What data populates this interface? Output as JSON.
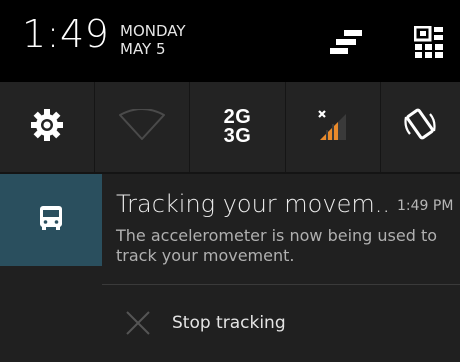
{
  "status": {
    "time": "1:49",
    "day": "MONDAY",
    "date": "MAY 5"
  },
  "header_icons": [
    "settings-panel-icon",
    "qr-user-icon"
  ],
  "quick_settings": [
    {
      "name": "settings",
      "icon": "gear-icon"
    },
    {
      "name": "wifi",
      "icon": "wifi-icon",
      "state": "off"
    },
    {
      "name": "network-mode",
      "text": "2G\n3G"
    },
    {
      "name": "mobile-signal",
      "icon": "signal-icon"
    },
    {
      "name": "auto-rotate",
      "icon": "rotate-icon"
    }
  ],
  "notification": {
    "icon": "bus-icon",
    "title": "Tracking your movem..",
    "time": "1:49 PM",
    "body": "The accelerometer is now being used to track your movement.",
    "action": {
      "label": "Stop tracking",
      "icon": "close-icon"
    }
  },
  "colors": {
    "accent": "#2a4f5e",
    "signal": "#e98a2b"
  }
}
